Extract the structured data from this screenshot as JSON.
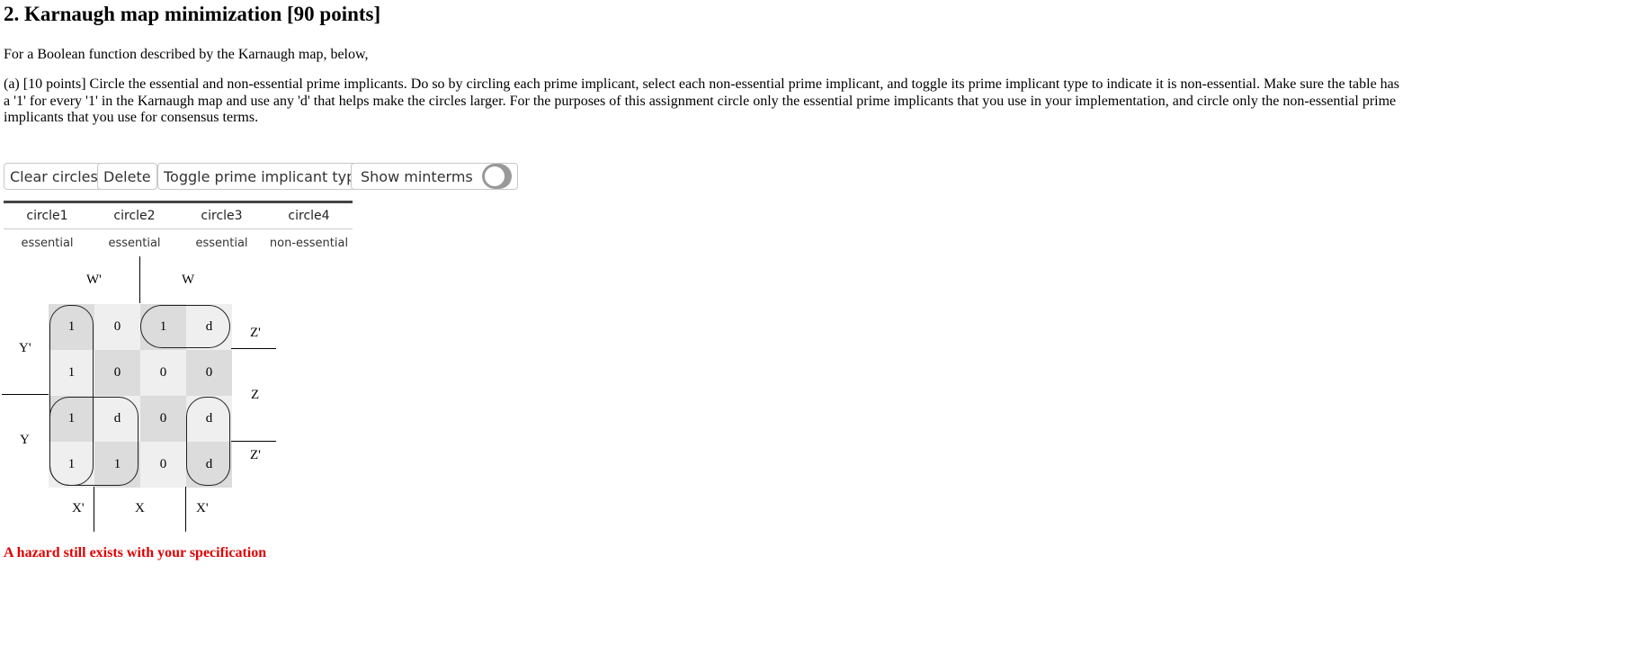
{
  "title": "2. Karnaugh map minimization [90 points]",
  "intro": "For a Boolean function described by the Karnaugh map, below,",
  "question": "(a) [10 points] Circle the essential and non-essential prime implicants. Do so by circling each prime implicant, select each non-essential prime implicant, and toggle its prime implicant type to indicate it is non-essential. Make sure the table has a '1' for every '1' in the Karnaugh map and use any 'd' that helps make the circles larger. For the purposes of this assignment circle only the essential prime implicants that you use in your implementation, and circle only the non-essential prime implicants that you use for consensus terms.",
  "toolbar": {
    "clear_label": "Clear circles",
    "delete_label": "Delete",
    "toggle_label": "Toggle prime implicant type",
    "show_minterms_label": "Show minterms",
    "show_minterms_on": false
  },
  "implicants": {
    "headers": [
      "circle1",
      "circle2",
      "circle3",
      "circle4"
    ],
    "types": [
      "essential",
      "essential",
      "essential",
      "non-essential"
    ]
  },
  "kmap": {
    "top_labels": [
      "W'",
      "W"
    ],
    "left_labels": [
      "Y'",
      "Y"
    ],
    "right_labels": [
      "Z'",
      "Z",
      "Z'"
    ],
    "bottom_labels": [
      "X'",
      "X",
      "X'"
    ],
    "rows": [
      [
        "1",
        "0",
        "1",
        "d"
      ],
      [
        "1",
        "0",
        "0",
        "0"
      ],
      [
        "1",
        "d",
        "0",
        "d"
      ],
      [
        "1",
        "1",
        "0",
        "d"
      ]
    ]
  },
  "hazard_text": "A hazard still exists with your specification"
}
